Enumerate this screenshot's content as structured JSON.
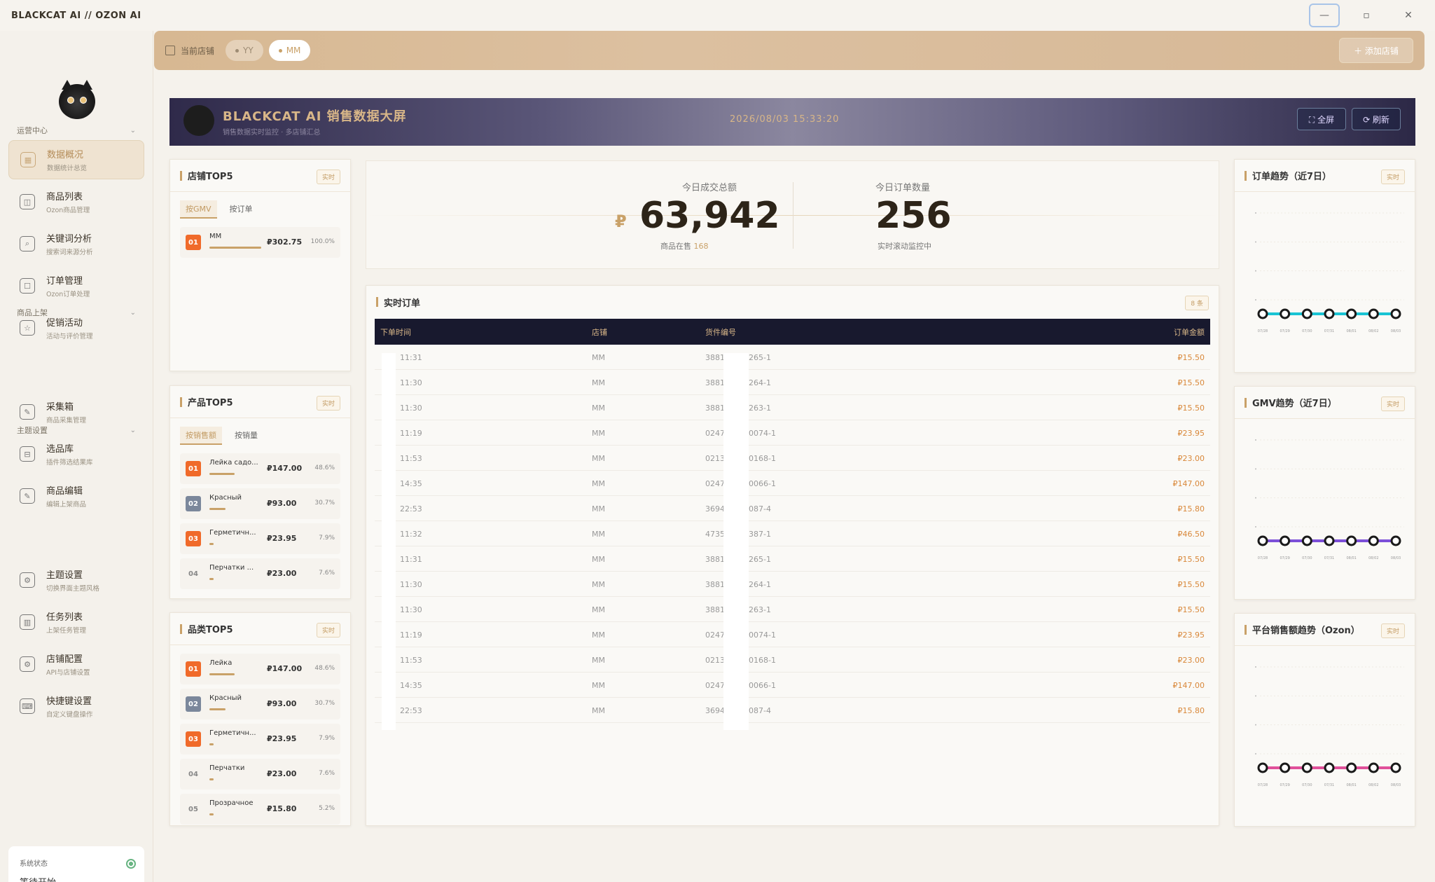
{
  "app": {
    "title": "BLACKCAT AI // OZON AI",
    "min": "—",
    "max": "▫",
    "close": "✕"
  },
  "sidebar": {
    "sections": [
      {
        "label": "运营中心"
      },
      {
        "label": "商品上架"
      },
      {
        "label": "主题设置"
      }
    ],
    "items": [
      {
        "title": "数据概况",
        "sub": "数据统计总览",
        "icon": "▦"
      },
      {
        "title": "商品列表",
        "sub": "Ozon商品管理",
        "icon": "◫"
      },
      {
        "title": "关键词分析",
        "sub": "搜索词来源分析",
        "icon": "⌕"
      },
      {
        "title": "订单管理",
        "sub": "Ozon订单处理",
        "icon": "☐"
      },
      {
        "title": "促销活动",
        "sub": "活动与评价管理",
        "icon": "☆"
      },
      {
        "title": "采集箱",
        "sub": "商品采集管理",
        "icon": "✎"
      },
      {
        "title": "选品库",
        "sub": "插件筛选结果库",
        "icon": "⊟"
      },
      {
        "title": "商品编辑",
        "sub": "编辑上架商品",
        "icon": "✎"
      },
      {
        "title": "主题设置",
        "sub": "切换界面主题风格",
        "icon": "⚙"
      },
      {
        "title": "任务列表",
        "sub": "上架任务管理",
        "icon": "▥"
      },
      {
        "title": "店铺配置",
        "sub": "API与店铺设置",
        "icon": "⚙"
      },
      {
        "title": "快捷键设置",
        "sub": "自定义键盘操作",
        "icon": "⌨"
      }
    ],
    "status": {
      "label": "系统状态",
      "value": "等待开始"
    }
  },
  "storebar": {
    "label": "当前店铺",
    "stores": [
      "YY",
      "MM"
    ],
    "add": "＋  添加店铺"
  },
  "banner": {
    "title": "BLACKCAT AI 销售数据大屏",
    "subtitle": "销售数据实时监控 · 多店铺汇总",
    "time": "2026/08/03 15:33:20",
    "fullscreen": "⛶ 全屏",
    "refresh": "⟳ 刷新"
  },
  "kpi": {
    "gmv_label": "今日成交总额",
    "currency": "₽",
    "gmv": "63,942",
    "on_sale_prefix": "商品在售",
    "on_sale": "168",
    "orders_label": "今日订单数量",
    "orders": "256",
    "orders_sub": "实时滚动监控中"
  },
  "badge": "实时",
  "store_top": {
    "title": "店铺TOP5",
    "tabs": [
      "按GMV",
      "按订单"
    ],
    "rows": [
      {
        "no": "01",
        "name": "MM",
        "price": "₽302.75",
        "pct": "100.0%",
        "share": 1.0
      }
    ]
  },
  "product_top": {
    "title": "产品TOP5",
    "tabs": [
      "按销售额",
      "按销量"
    ],
    "rows": [
      {
        "no": "01",
        "name": "Лейка садо...",
        "price": "₽147.00",
        "pct": "48.6%",
        "share": 0.486
      },
      {
        "no": "02",
        "name": "Красный",
        "price": "₽93.00",
        "pct": "30.7%",
        "share": 0.307
      },
      {
        "no": "03",
        "name": "Герметичн...",
        "price": "₽23.95",
        "pct": "7.9%",
        "share": 0.079
      },
      {
        "no": "04",
        "name": "Перчатки ...",
        "price": "₽23.00",
        "pct": "7.6%",
        "share": 0.076
      }
    ]
  },
  "category_top": {
    "title": "品类TOP5",
    "rows": [
      {
        "no": "01",
        "name": "Лейка",
        "price": "₽147.00",
        "pct": "48.6%",
        "share": 0.486
      },
      {
        "no": "02",
        "name": "Красный",
        "price": "₽93.00",
        "pct": "30.7%",
        "share": 0.307
      },
      {
        "no": "03",
        "name": "Герметичн...",
        "price": "₽23.95",
        "pct": "7.9%",
        "share": 0.079
      },
      {
        "no": "04",
        "name": "Перчатки",
        "price": "₽23.00",
        "pct": "7.6%",
        "share": 0.076
      },
      {
        "no": "05",
        "name": "Прозрачное",
        "price": "₽15.80",
        "pct": "5.2%",
        "share": 0.052
      }
    ]
  },
  "orders": {
    "title": "实时订单",
    "count": "8 条",
    "cols": [
      "下单时间",
      "店铺",
      "货件编号",
      "订单金额"
    ],
    "rows": [
      {
        "time": "11:31",
        "store": "MM",
        "sku_a": "3881",
        "sku_b": "265-1",
        "amt": "₽15.50"
      },
      {
        "time": "11:30",
        "store": "MM",
        "sku_a": "3881",
        "sku_b": "264-1",
        "amt": "₽15.50"
      },
      {
        "time": "11:30",
        "store": "MM",
        "sku_a": "3881",
        "sku_b": "263-1",
        "amt": "₽15.50"
      },
      {
        "time": "11:19",
        "store": "MM",
        "sku_a": "0247",
        "sku_b": "0074-1",
        "amt": "₽23.95"
      },
      {
        "time": "11:53",
        "store": "MM",
        "sku_a": "0213",
        "sku_b": "0168-1",
        "amt": "₽23.00"
      },
      {
        "time": "14:35",
        "store": "MM",
        "sku_a": "0247",
        "sku_b": "0066-1",
        "amt": "₽147.00"
      },
      {
        "time": "22:53",
        "store": "MM",
        "sku_a": "3694",
        "sku_b": "087-4",
        "amt": "₽15.80"
      },
      {
        "time": "11:32",
        "store": "MM",
        "sku_a": "4735",
        "sku_b": "387-1",
        "amt": "₽46.50"
      },
      {
        "time": "11:31",
        "store": "MM",
        "sku_a": "3881",
        "sku_b": "265-1",
        "amt": "₽15.50"
      },
      {
        "time": "11:30",
        "store": "MM",
        "sku_a": "3881",
        "sku_b": "264-1",
        "amt": "₽15.50"
      },
      {
        "time": "11:30",
        "store": "MM",
        "sku_a": "3881",
        "sku_b": "263-1",
        "amt": "₽15.50"
      },
      {
        "time": "11:19",
        "store": "MM",
        "sku_a": "0247",
        "sku_b": "0074-1",
        "amt": "₽23.95"
      },
      {
        "time": "11:53",
        "store": "MM",
        "sku_a": "0213",
        "sku_b": "0168-1",
        "amt": "₽23.00"
      },
      {
        "time": "14:35",
        "store": "MM",
        "sku_a": "0247",
        "sku_b": "0066-1",
        "amt": "₽147.00"
      },
      {
        "time": "22:53",
        "store": "MM",
        "sku_a": "3694",
        "sku_b": "087-4",
        "amt": "₽15.80"
      }
    ]
  },
  "chart_data": [
    {
      "type": "line",
      "title": "订单趋势（近7日）",
      "color": "#19c4d4",
      "x": [
        "07/28",
        "07/29",
        "07/30",
        "07/31",
        "08/01",
        "08/02",
        "08/03"
      ],
      "values": [
        0,
        0,
        0,
        0,
        0,
        0,
        0
      ],
      "grid": true
    },
    {
      "type": "line",
      "title": "GMV趋势（近7日）",
      "color": "#7c4fd8",
      "x": [
        "07/28",
        "07/29",
        "07/30",
        "07/31",
        "08/01",
        "08/02",
        "08/03"
      ],
      "values": [
        0,
        0,
        0,
        0,
        0,
        0,
        0
      ],
      "grid": true
    },
    {
      "type": "line",
      "title": "平台销售额趋势（Ozon）",
      "color": "#e0509a",
      "x": [
        "07/28",
        "07/29",
        "07/30",
        "07/31",
        "08/01",
        "08/02",
        "08/03"
      ],
      "values": [
        0,
        0,
        0,
        0,
        0,
        0,
        0
      ],
      "grid": true
    }
  ]
}
